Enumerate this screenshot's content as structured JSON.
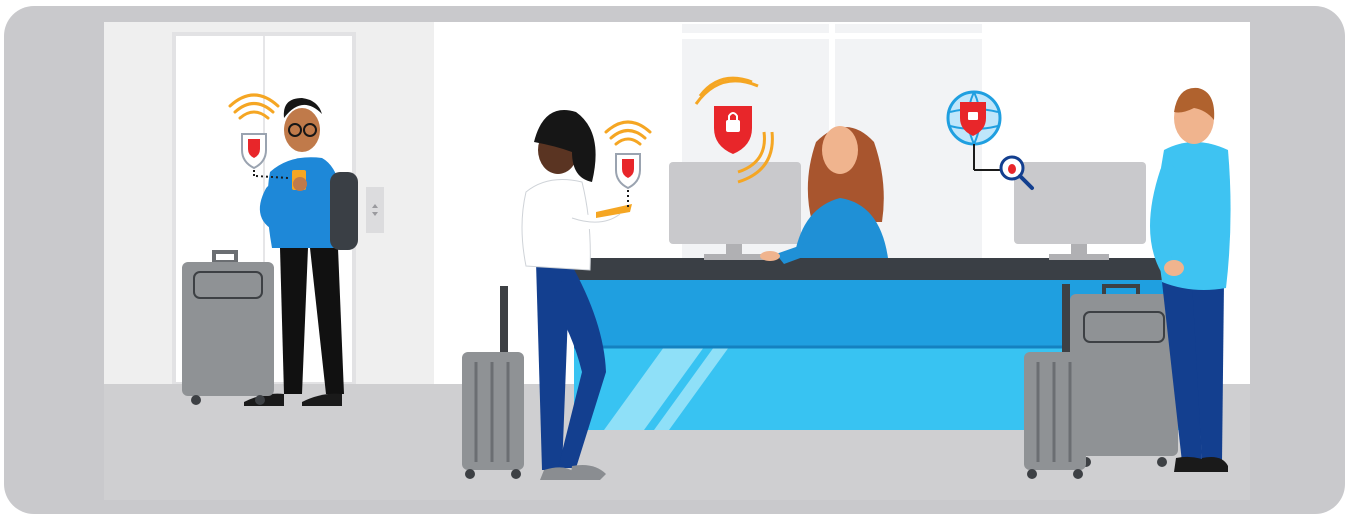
{
  "scene": {
    "colors": {
      "frame": "#c9c9cc",
      "floor": "#cfcfd1",
      "desk_front": "#1f9fe0",
      "desk_top": "#3a3f45",
      "security_red": "#e8262a",
      "signal_orange": "#f5a623",
      "luggage": "#8f9295"
    },
    "icons": [
      "wifi-signal-icon",
      "shield-lock-icon",
      "globe-shield-lock-icon",
      "magnifier-bug-icon",
      "phone-icon",
      "elevator-buttons-icon"
    ],
    "people_count": 4,
    "suitcase_count": 4
  }
}
